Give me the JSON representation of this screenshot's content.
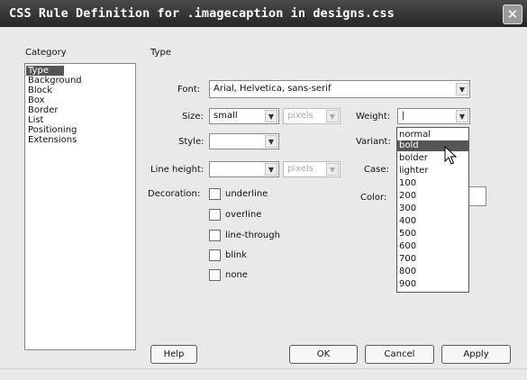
{
  "window": {
    "title": "CSS Rule Definition for .imagecaption in designs.css"
  },
  "category": {
    "header": "Category",
    "items": [
      "Type",
      "Background",
      "Block",
      "Box",
      "Border",
      "List",
      "Positioning",
      "Extensions"
    ],
    "selected": "Type"
  },
  "panel": {
    "header": "Type"
  },
  "fields": {
    "font_label": "Font:",
    "font_value": "Arial, Helvetica, sans-serif",
    "size_label": "Size:",
    "size_value": "small",
    "size_unit": "pixels",
    "weight_label": "Weight:",
    "weight_value": "|",
    "style_label": "Style:",
    "style_value": "",
    "variant_label": "Variant:",
    "line_height_label": "Line height:",
    "line_height_value": "",
    "line_height_unit": "pixels",
    "case_label": "Case:",
    "color_label": "Color:",
    "decoration_label": "Decoration:"
  },
  "decorations": [
    "underline",
    "overline",
    "line-through",
    "blink",
    "none"
  ],
  "weight_options": [
    "normal",
    "bold",
    "bolder",
    "lighter",
    "100",
    "200",
    "300",
    "400",
    "500",
    "600",
    "700",
    "800",
    "900"
  ],
  "weight_highlighted": "bold",
  "buttons": {
    "help": "Help",
    "ok": "OK",
    "cancel": "Cancel",
    "apply": "Apply"
  },
  "icons": {
    "close": "close-icon",
    "dropdown": "chevron-down-icon",
    "cursor": "pointer-cursor-icon"
  }
}
